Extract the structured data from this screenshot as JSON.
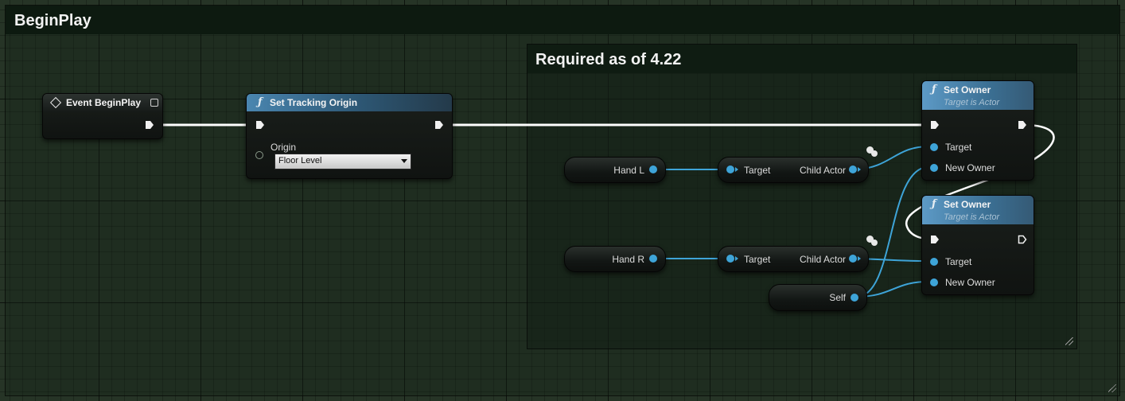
{
  "comments": {
    "outer_title": "BeginPlay",
    "inner_title": "Required as of 4.22"
  },
  "nodes": {
    "event_begin_play": {
      "title": "Event BeginPlay"
    },
    "set_tracking_origin": {
      "icon": "function-icon",
      "title": "Set Tracking Origin",
      "origin_label": "Origin",
      "origin_value": "Floor Level"
    },
    "set_owner_1": {
      "icon": "function-icon",
      "title": "Set Owner",
      "subtitle": "Target is Actor",
      "target_label": "Target",
      "new_owner_label": "New Owner"
    },
    "set_owner_2": {
      "icon": "function-icon",
      "title": "Set Owner",
      "subtitle": "Target is Actor",
      "target_label": "Target",
      "new_owner_label": "New Owner"
    },
    "hand_l": {
      "label": "Hand L"
    },
    "hand_r": {
      "label": "Hand R"
    },
    "child_actor_l": {
      "target_label": "Target",
      "output_label": "Child Actor"
    },
    "child_actor_r": {
      "target_label": "Target",
      "output_label": "Child Actor"
    },
    "self": {
      "label": "Self"
    }
  },
  "colors": {
    "exec_wire": "#ffffff",
    "object_wire": "#3ea4d8",
    "function_header": "#3b6f93",
    "comment_title_bg": "#0d1a10",
    "graph_bg": "#263426"
  }
}
